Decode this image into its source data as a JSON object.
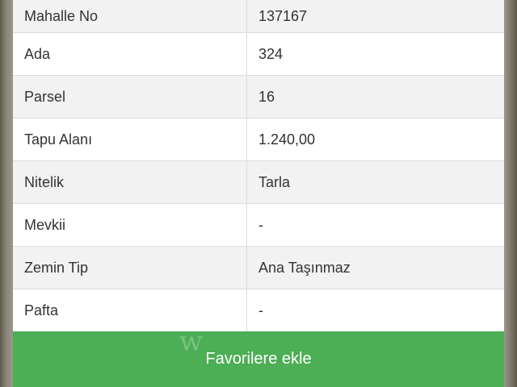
{
  "details": {
    "rows": [
      {
        "label": "Mahalle No",
        "value": "137167"
      },
      {
        "label": "Ada",
        "value": "324"
      },
      {
        "label": "Parsel",
        "value": "16"
      },
      {
        "label": "Tapu Alanı",
        "value": "1.240,00"
      },
      {
        "label": "Nitelik",
        "value": "Tarla"
      },
      {
        "label": "Mevkii",
        "value": "-"
      },
      {
        "label": "Zemin Tip",
        "value": "Ana Taşınmaz"
      },
      {
        "label": "Pafta",
        "value": "-"
      }
    ]
  },
  "actions": {
    "favorite_label": "Favorilere ekle"
  },
  "colors": {
    "button_green": "#4cae55",
    "row_alt": "#f2f2f2"
  }
}
